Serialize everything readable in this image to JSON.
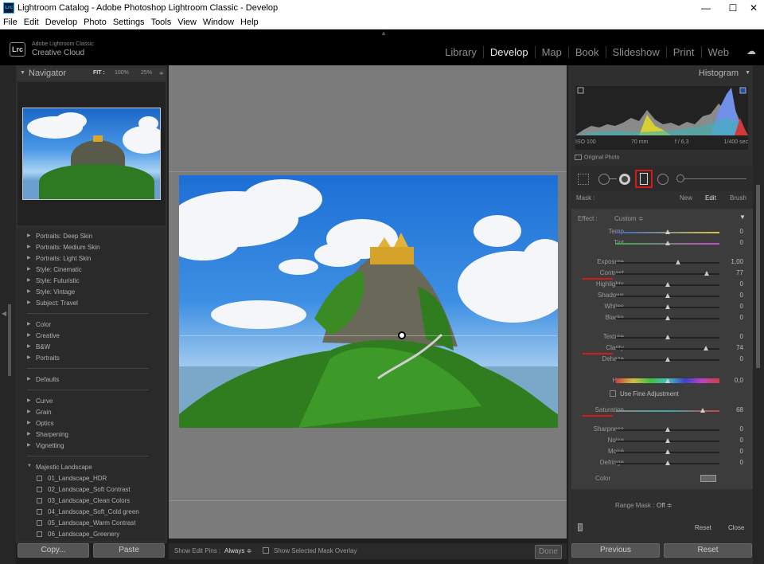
{
  "window": {
    "title": "Lightroom Catalog - Adobe Photoshop Lightroom Classic - Develop",
    "icon_text": "Lrc",
    "minimize": "—",
    "maximize": "☐",
    "close": "✕"
  },
  "menu": [
    "File",
    "Edit",
    "Develop",
    "Photo",
    "Settings",
    "Tools",
    "View",
    "Window",
    "Help"
  ],
  "identity": {
    "logo": "Lrc",
    "line1": "Adobe Lightroom Classic",
    "line2": "Creative Cloud"
  },
  "modules": [
    {
      "label": "Library",
      "active": false
    },
    {
      "label": "Develop",
      "active": true
    },
    {
      "label": "Map",
      "active": false
    },
    {
      "label": "Book",
      "active": false
    },
    {
      "label": "Slideshow",
      "active": false
    },
    {
      "label": "Print",
      "active": false
    },
    {
      "label": "Web",
      "active": false
    }
  ],
  "navigator": {
    "title": "Navigator",
    "zoom_fit": "FIT :",
    "zoom_100": "100%",
    "zoom_25": "25%",
    "zoom_arrow": "≑"
  },
  "presets": [
    {
      "label": "Portraits: Deep Skin",
      "kind": "folder"
    },
    {
      "label": "Portraits: Medium Skin",
      "kind": "folder"
    },
    {
      "label": "Portraits: Light Skin",
      "kind": "folder"
    },
    {
      "label": "Style: Cinematic",
      "kind": "folder"
    },
    {
      "label": "Style: Futuristic",
      "kind": "folder"
    },
    {
      "label": "Style: Vintage",
      "kind": "folder"
    },
    {
      "label": "Subject: Travel",
      "kind": "folder"
    },
    {
      "label": "Color",
      "kind": "folder"
    },
    {
      "label": "Creative",
      "kind": "folder"
    },
    {
      "label": "B&W",
      "kind": "folder"
    },
    {
      "label": "Portraits",
      "kind": "folder"
    },
    {
      "label": "Defaults",
      "kind": "folder"
    },
    {
      "label": "Curve",
      "kind": "folder"
    },
    {
      "label": "Grain",
      "kind": "folder"
    },
    {
      "label": "Optics",
      "kind": "folder"
    },
    {
      "label": "Sharpening",
      "kind": "folder"
    },
    {
      "label": "Vignetting",
      "kind": "folder"
    },
    {
      "label": "Majestic Landscape",
      "kind": "open-folder"
    },
    {
      "label": "01_Landscape_HDR",
      "kind": "preset"
    },
    {
      "label": "02_Landscape_Soft Contrast",
      "kind": "preset"
    },
    {
      "label": "03_Landscape_Clean Colors",
      "kind": "preset"
    },
    {
      "label": "04_Landscape_Soft_Cold green",
      "kind": "preset"
    },
    {
      "label": "05_Landscape_Warm Contrast",
      "kind": "preset"
    },
    {
      "label": "06_Landscape_Greenery",
      "kind": "preset"
    }
  ],
  "left_buttons": {
    "copy": "Copy...",
    "paste": "Paste"
  },
  "toolbar": {
    "edit_pins_label": "Show Edit Pins :",
    "edit_pins_value": "Always ≑",
    "overlay_label": "Show Selected Mask Overlay",
    "done": "Done"
  },
  "histogram": {
    "title": "Histogram",
    "iso": "ISO 100",
    "focal": "70 mm",
    "aperture": "f / 6,3",
    "shutter": "1/400 sec",
    "original_photo": "Original Photo"
  },
  "mask": {
    "label": "Mask :",
    "new": "New",
    "edit": "Edit",
    "brush": "Brush"
  },
  "effect": {
    "label": "Effect :",
    "value": "Custom ≑"
  },
  "sliders": [
    {
      "label": "Temp",
      "value": "0",
      "pos": 0.5,
      "gradient": "linear-gradient(90deg,#3a64c8,#e0c43a)",
      "underline": false
    },
    {
      "label": "Tint",
      "value": "0",
      "pos": 0.5,
      "gradient": "linear-gradient(90deg,#3cae48,#c84ac8)",
      "underline": false
    },
    {
      "label": "Exposure",
      "value": "1,00",
      "pos": 0.6,
      "gradient": "",
      "underline": false
    },
    {
      "label": "Contrast",
      "value": "77",
      "pos": 0.88,
      "gradient": "",
      "underline": true
    },
    {
      "label": "Highlights",
      "value": "0",
      "pos": 0.5,
      "gradient": "",
      "underline": false
    },
    {
      "label": "Shadows",
      "value": "0",
      "pos": 0.5,
      "gradient": "",
      "underline": false
    },
    {
      "label": "Whites",
      "value": "0",
      "pos": 0.5,
      "gradient": "",
      "underline": false
    },
    {
      "label": "Blacks",
      "value": "0",
      "pos": 0.5,
      "gradient": "",
      "underline": false
    },
    {
      "label": "Texture",
      "value": "0",
      "pos": 0.5,
      "gradient": "",
      "underline": false
    },
    {
      "label": "Clarity",
      "value": "74",
      "pos": 0.87,
      "gradient": "",
      "underline": true
    },
    {
      "label": "Dehaze",
      "value": "0",
      "pos": 0.5,
      "gradient": "",
      "underline": false
    },
    {
      "label": "Hue",
      "value": "0,0",
      "pos": 0.5,
      "gradient": "linear-gradient(90deg,#d04040,#d0c040,#40c040,#40c0c0,#4040d0,#c040c0,#d04040)",
      "underline": false
    },
    {
      "label": "Saturation",
      "value": "68",
      "pos": 0.84,
      "gradient": "linear-gradient(90deg,#888,#3aa,#d04040)",
      "underline": true
    },
    {
      "label": "Sharpness",
      "value": "0",
      "pos": 0.5,
      "gradient": "",
      "underline": false
    },
    {
      "label": "Noise",
      "value": "0",
      "pos": 0.5,
      "gradient": "",
      "underline": false
    },
    {
      "label": "Moiré",
      "value": "0",
      "pos": 0.5,
      "gradient": "",
      "underline": false
    },
    {
      "label": "Defringe",
      "value": "0",
      "pos": 0.5,
      "gradient": "",
      "underline": false
    }
  ],
  "fine_adjust": "Use Fine Adjustment",
  "color_label": "Color",
  "range_mask": {
    "label": "Range Mask :",
    "value": "Off ≑"
  },
  "panel_footer": {
    "reset": "Reset",
    "close": "Close"
  },
  "right_buttons": {
    "previous": "Previous",
    "reset": "Reset"
  },
  "colors": {
    "accent_red": "#d41b1b",
    "panel_bg": "#3c3c3c",
    "canvas_bg": "#7b7b7b"
  }
}
